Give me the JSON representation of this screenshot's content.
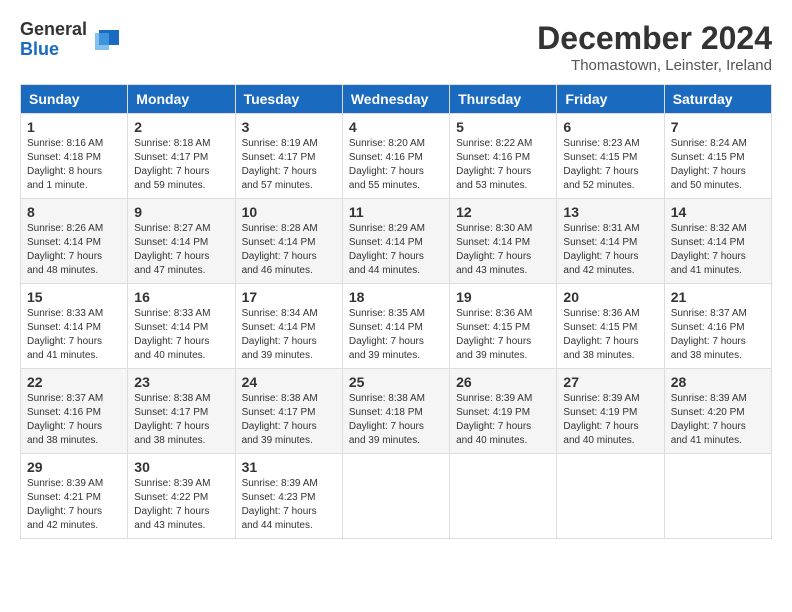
{
  "logo": {
    "general": "General",
    "blue": "Blue"
  },
  "title": "December 2024",
  "location": "Thomastown, Leinster, Ireland",
  "weekdays": [
    "Sunday",
    "Monday",
    "Tuesday",
    "Wednesday",
    "Thursday",
    "Friday",
    "Saturday"
  ],
  "weeks": [
    [
      {
        "day": "1",
        "sunrise": "8:16 AM",
        "sunset": "4:18 PM",
        "daylight": "8 hours and 1 minute."
      },
      {
        "day": "2",
        "sunrise": "8:18 AM",
        "sunset": "4:17 PM",
        "daylight": "7 hours and 59 minutes."
      },
      {
        "day": "3",
        "sunrise": "8:19 AM",
        "sunset": "4:17 PM",
        "daylight": "7 hours and 57 minutes."
      },
      {
        "day": "4",
        "sunrise": "8:20 AM",
        "sunset": "4:16 PM",
        "daylight": "7 hours and 55 minutes."
      },
      {
        "day": "5",
        "sunrise": "8:22 AM",
        "sunset": "4:16 PM",
        "daylight": "7 hours and 53 minutes."
      },
      {
        "day": "6",
        "sunrise": "8:23 AM",
        "sunset": "4:15 PM",
        "daylight": "7 hours and 52 minutes."
      },
      {
        "day": "7",
        "sunrise": "8:24 AM",
        "sunset": "4:15 PM",
        "daylight": "7 hours and 50 minutes."
      }
    ],
    [
      {
        "day": "8",
        "sunrise": "8:26 AM",
        "sunset": "4:14 PM",
        "daylight": "7 hours and 48 minutes."
      },
      {
        "day": "9",
        "sunrise": "8:27 AM",
        "sunset": "4:14 PM",
        "daylight": "7 hours and 47 minutes."
      },
      {
        "day": "10",
        "sunrise": "8:28 AM",
        "sunset": "4:14 PM",
        "daylight": "7 hours and 46 minutes."
      },
      {
        "day": "11",
        "sunrise": "8:29 AM",
        "sunset": "4:14 PM",
        "daylight": "7 hours and 44 minutes."
      },
      {
        "day": "12",
        "sunrise": "8:30 AM",
        "sunset": "4:14 PM",
        "daylight": "7 hours and 43 minutes."
      },
      {
        "day": "13",
        "sunrise": "8:31 AM",
        "sunset": "4:14 PM",
        "daylight": "7 hours and 42 minutes."
      },
      {
        "day": "14",
        "sunrise": "8:32 AM",
        "sunset": "4:14 PM",
        "daylight": "7 hours and 41 minutes."
      }
    ],
    [
      {
        "day": "15",
        "sunrise": "8:33 AM",
        "sunset": "4:14 PM",
        "daylight": "7 hours and 41 minutes."
      },
      {
        "day": "16",
        "sunrise": "8:33 AM",
        "sunset": "4:14 PM",
        "daylight": "7 hours and 40 minutes."
      },
      {
        "day": "17",
        "sunrise": "8:34 AM",
        "sunset": "4:14 PM",
        "daylight": "7 hours and 39 minutes."
      },
      {
        "day": "18",
        "sunrise": "8:35 AM",
        "sunset": "4:14 PM",
        "daylight": "7 hours and 39 minutes."
      },
      {
        "day": "19",
        "sunrise": "8:36 AM",
        "sunset": "4:15 PM",
        "daylight": "7 hours and 39 minutes."
      },
      {
        "day": "20",
        "sunrise": "8:36 AM",
        "sunset": "4:15 PM",
        "daylight": "7 hours and 38 minutes."
      },
      {
        "day": "21",
        "sunrise": "8:37 AM",
        "sunset": "4:16 PM",
        "daylight": "7 hours and 38 minutes."
      }
    ],
    [
      {
        "day": "22",
        "sunrise": "8:37 AM",
        "sunset": "4:16 PM",
        "daylight": "7 hours and 38 minutes."
      },
      {
        "day": "23",
        "sunrise": "8:38 AM",
        "sunset": "4:17 PM",
        "daylight": "7 hours and 38 minutes."
      },
      {
        "day": "24",
        "sunrise": "8:38 AM",
        "sunset": "4:17 PM",
        "daylight": "7 hours and 39 minutes."
      },
      {
        "day": "25",
        "sunrise": "8:38 AM",
        "sunset": "4:18 PM",
        "daylight": "7 hours and 39 minutes."
      },
      {
        "day": "26",
        "sunrise": "8:39 AM",
        "sunset": "4:19 PM",
        "daylight": "7 hours and 40 minutes."
      },
      {
        "day": "27",
        "sunrise": "8:39 AM",
        "sunset": "4:19 PM",
        "daylight": "7 hours and 40 minutes."
      },
      {
        "day": "28",
        "sunrise": "8:39 AM",
        "sunset": "4:20 PM",
        "daylight": "7 hours and 41 minutes."
      }
    ],
    [
      {
        "day": "29",
        "sunrise": "8:39 AM",
        "sunset": "4:21 PM",
        "daylight": "7 hours and 42 minutes."
      },
      {
        "day": "30",
        "sunrise": "8:39 AM",
        "sunset": "4:22 PM",
        "daylight": "7 hours and 43 minutes."
      },
      {
        "day": "31",
        "sunrise": "8:39 AM",
        "sunset": "4:23 PM",
        "daylight": "7 hours and 44 minutes."
      },
      null,
      null,
      null,
      null
    ]
  ],
  "labels": {
    "sunrise": "Sunrise: ",
    "sunset": "Sunset: ",
    "daylight": "Daylight hours"
  }
}
